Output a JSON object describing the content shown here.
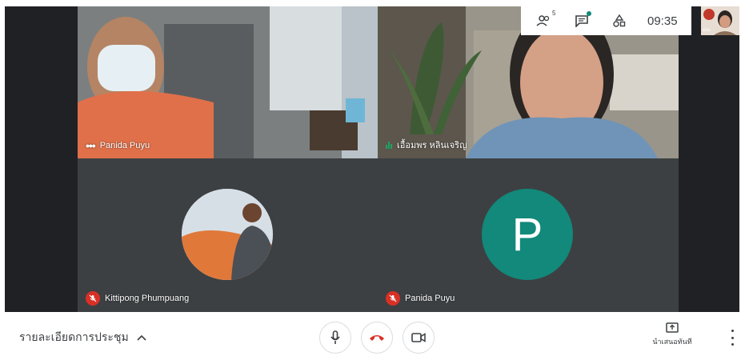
{
  "top_bar": {
    "people_count": "5",
    "time": "09:35",
    "self_view_label": "คุณ"
  },
  "tiles": [
    {
      "name": "Panida Puyu",
      "state": "more-options"
    },
    {
      "name": "เอื้อมพร หลินเจริญ",
      "state": "speaking"
    },
    {
      "name": "Kittipong Phumpuang",
      "state": "muted",
      "avatar": "photo"
    },
    {
      "name": "Panida Puyu",
      "state": "muted",
      "avatar": "letter",
      "avatar_letter": "P",
      "avatar_color": "#12897a"
    }
  ],
  "bottom_bar": {
    "meeting_details_label": "รายละเอียดการประชุม",
    "present_label": "นำเสนอทันที"
  },
  "colors": {
    "background": "#202124",
    "tile": "#3c4043",
    "end_call": "#d93025",
    "mute": "#d93025",
    "accent": "#12897a"
  },
  "icons": [
    "people-icon",
    "chat-icon",
    "activities-icon",
    "microphone-icon",
    "end-call-icon",
    "camera-icon",
    "present-icon",
    "more-vert-icon",
    "mic-off-icon",
    "chevron-up-icon"
  ]
}
